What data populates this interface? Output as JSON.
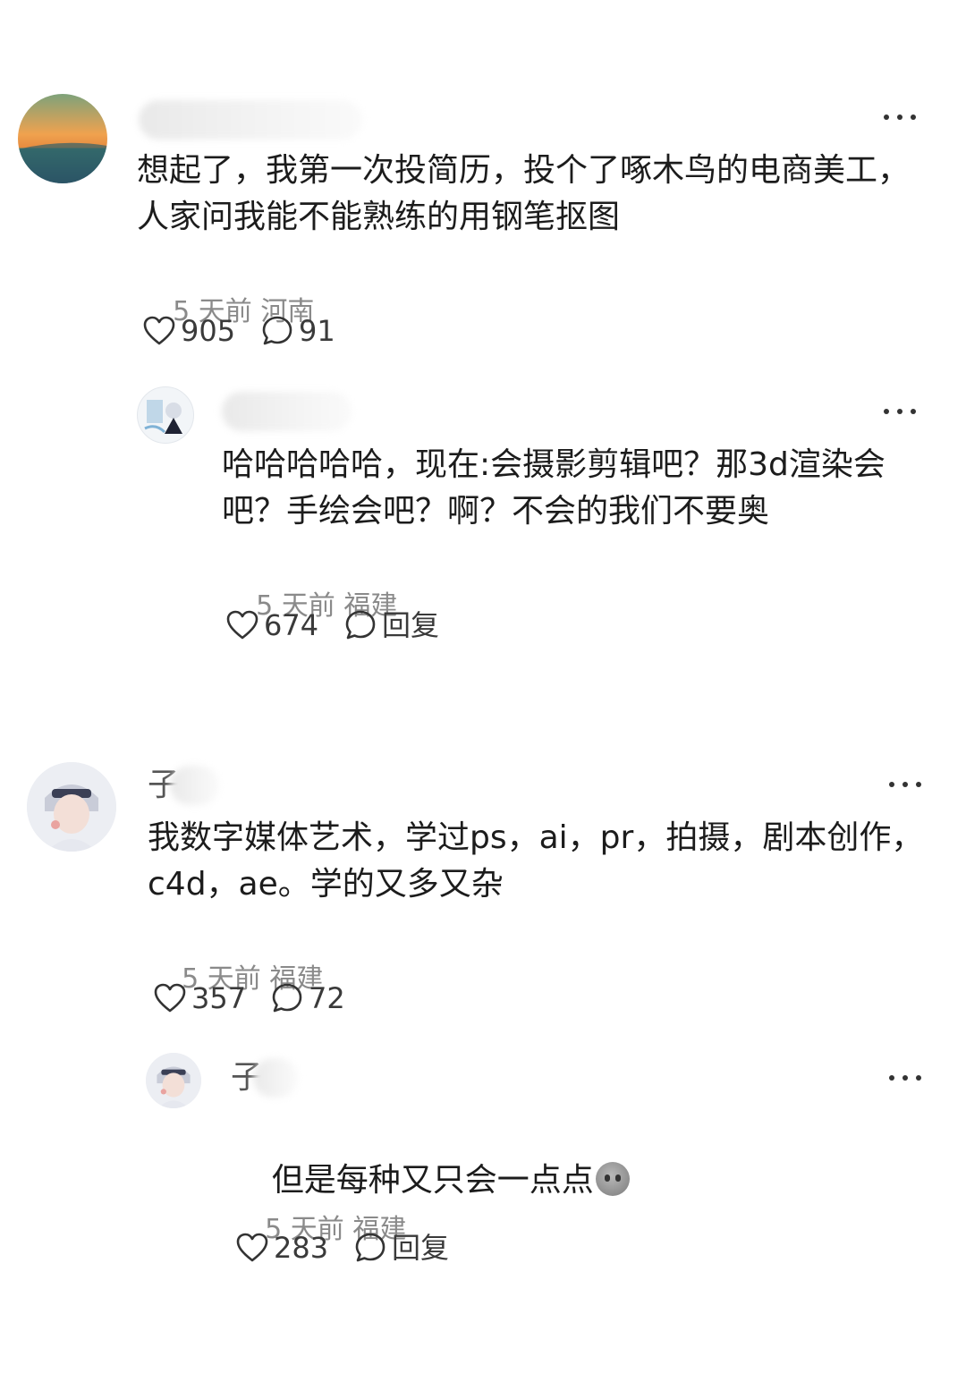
{
  "comments": [
    {
      "content": "想起了，我第一次投简历，投个了啄木鸟的电商美工，\n人家问我能不能熟练的用钢笔抠图",
      "time": "5 天前",
      "location": "河南",
      "likes": "905",
      "replies": "91",
      "avatar_colors": [
        "#e8974a",
        "#f0b45e",
        "#3f7a6d",
        "#243d5c"
      ]
    },
    {
      "content": "哈哈哈哈哈，现在:会摄影剪辑吧？那3d渲染会\n吧？手绘会吧？啊？不会的我们不要奥",
      "time": "5 天前",
      "location": "福建",
      "likes": "674",
      "reply_label": "回复"
    },
    {
      "username_glyph": "子",
      "content": "我数字媒体艺术，学过ps，ai，pr，拍摄，剧本创作，\nc4d，ae。学的又多又杂",
      "time": "5 天前",
      "location": "福建",
      "likes": "357",
      "replies": "72"
    },
    {
      "username_glyph": "子",
      "content": "但是每种又只会一点点",
      "time": "5 天前",
      "location": "福建",
      "likes": "283",
      "reply_label": "回复"
    }
  ]
}
